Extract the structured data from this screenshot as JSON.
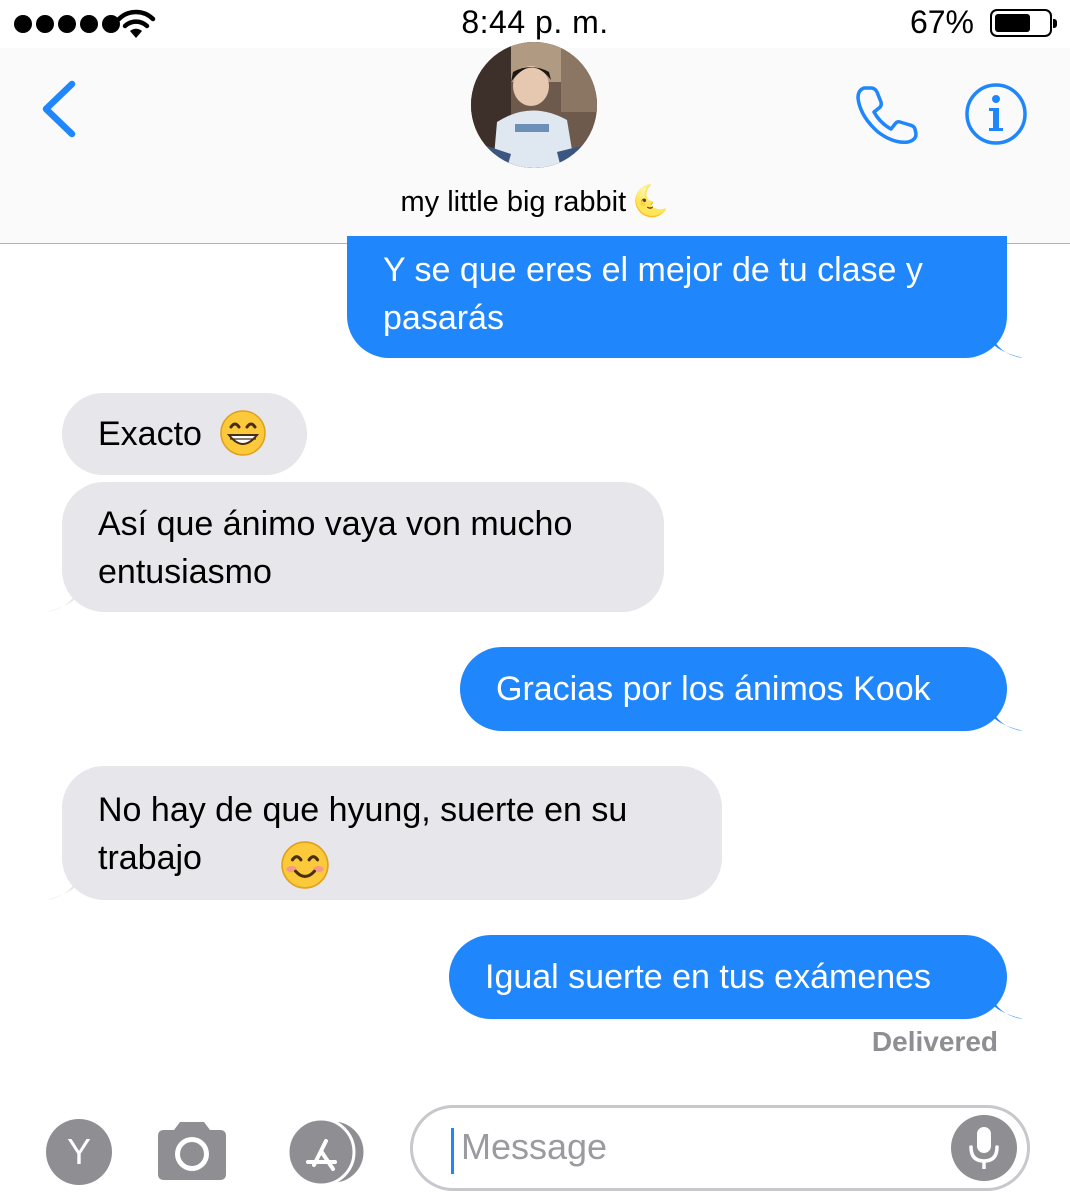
{
  "status_bar": {
    "time": "8:44 p. m.",
    "battery_percent": "67%",
    "battery_level": 0.67,
    "signal_bars": 5,
    "wifi_icon": "wifi-icon"
  },
  "header": {
    "contact_name": "my little big rabbit",
    "contact_emoji": "🌜",
    "back_icon": "chevron-left-icon",
    "phone_icon": "phone-icon",
    "info_icon": "info-icon"
  },
  "messages": [
    {
      "direction": "outgoing",
      "text": "Y se que eres el mejor de tu clase y\npasarás"
    },
    {
      "direction": "incoming",
      "text": "Exacto",
      "emoji": "grinning-face-icon"
    },
    {
      "direction": "incoming",
      "text": "Así que ánimo vaya von mucho\nentusiasmo"
    },
    {
      "direction": "outgoing",
      "text": "Gracias por los ánimos Kook"
    },
    {
      "direction": "incoming",
      "text": "No hay de que hyung, suerte en su\ntrabajo",
      "emoji": "smiling-face-icon"
    },
    {
      "direction": "outgoing",
      "text": "Igual suerte en tus exámenes"
    }
  ],
  "delivered_label": "Delivered",
  "input_bar": {
    "y_button_label": "Y",
    "placeholder": "Message",
    "camera_icon": "camera-icon",
    "appstore_icon": "app-store-icon",
    "mic_icon": "microphone-icon"
  },
  "colors": {
    "outgoing_bubble": "#1f86fc",
    "incoming_bubble": "#e6e6eb",
    "accent": "#1f86fc"
  }
}
